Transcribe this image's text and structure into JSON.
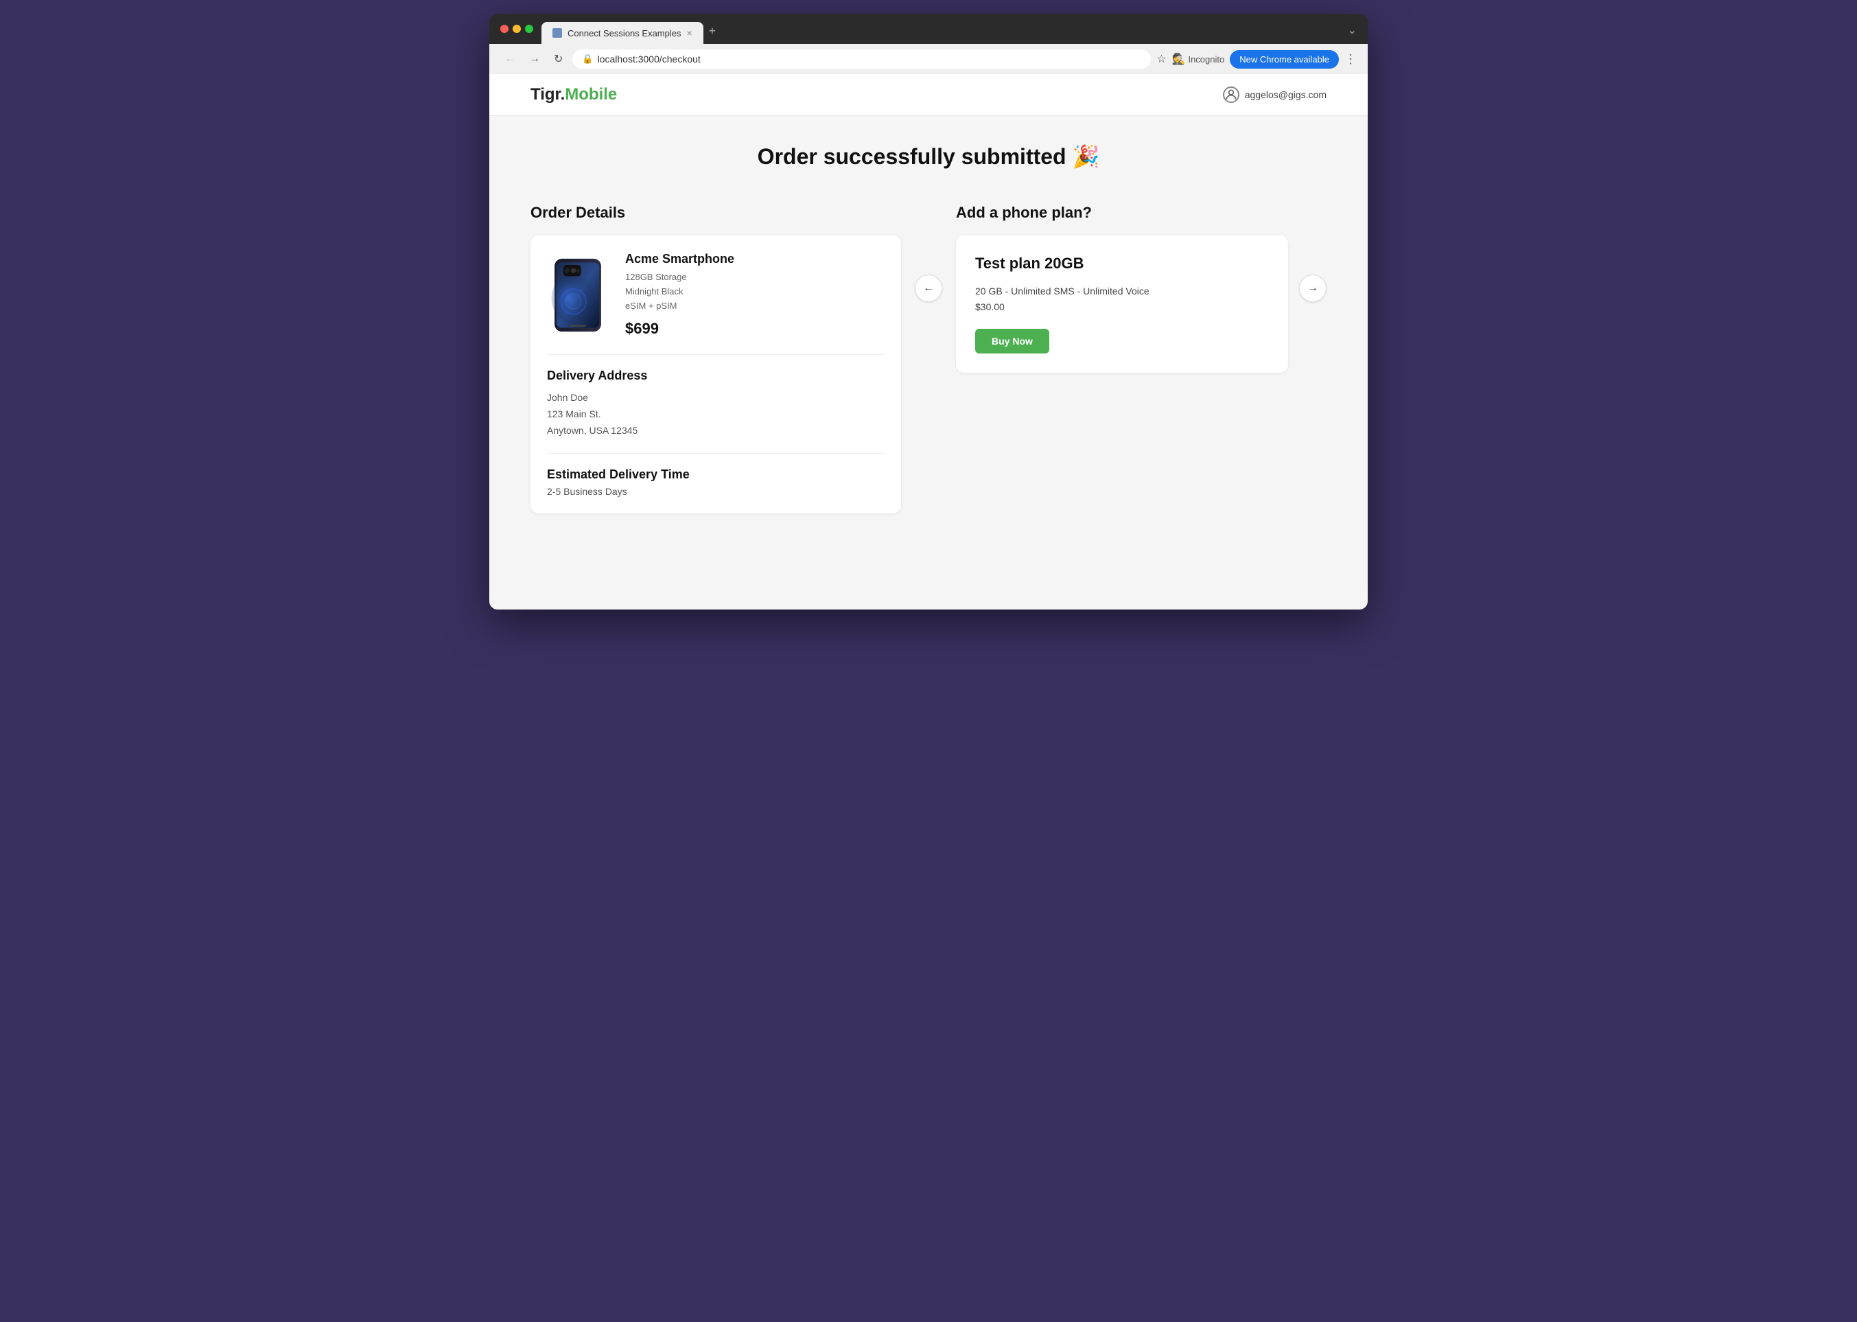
{
  "browser": {
    "tab_title": "Connect Sessions Examples",
    "tab_close": "×",
    "tab_add": "+",
    "tab_list": "⌄",
    "url": "localhost:3000/checkout",
    "back_btn": "←",
    "forward_btn": "→",
    "reload_btn": "↻",
    "bookmark_icon": "☆",
    "incognito_label": "Incognito",
    "new_chrome_label": "New Chrome available",
    "menu_icon": "⋮"
  },
  "site": {
    "logo_text": "Tigr.",
    "logo_green": "Mobile",
    "user_email": "aggelos@gigs.com"
  },
  "page": {
    "title": "Order successfully submitted 🎉",
    "order_section_title": "Order Details",
    "phone_plan_section_title": "Add a phone plan?"
  },
  "product": {
    "name": "Acme Smartphone",
    "storage": "128GB Storage",
    "color": "Midnight Black",
    "sim": "eSIM + pSIM",
    "price": "$699"
  },
  "delivery": {
    "title": "Delivery Address",
    "name": "John Doe",
    "street": "123 Main St.",
    "city": "Anytown, USA 12345"
  },
  "estimated_delivery": {
    "title": "Estimated Delivery Time",
    "time": "2-5 Business Days"
  },
  "plan": {
    "name": "Test plan 20GB",
    "features": "20 GB - Unlimited SMS - Unlimited Voice",
    "price": "$30.00",
    "buy_btn": "Buy Now",
    "prev_icon": "←",
    "next_icon": "→"
  },
  "colors": {
    "green": "#4caf50",
    "blue": "#1a73e8",
    "background": "#f5f5f5",
    "purple": "#3a3060"
  }
}
